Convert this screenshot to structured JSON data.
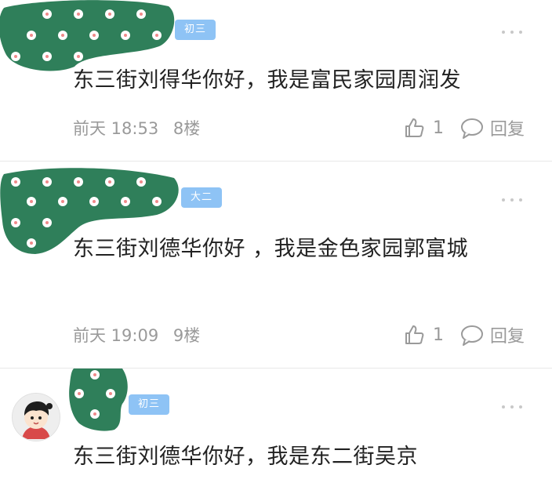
{
  "colors": {
    "blob": "#2f7f5a",
    "badge": "#8ec3f5",
    "text": "#222222",
    "meta": "#9a9a9a"
  },
  "comments": [
    {
      "badge": "初三",
      "content": "东三街刘得华你好，我是富民家园周润发",
      "time": "前天 18:53",
      "floor": "8楼",
      "likes": "1",
      "reply_label": "回复",
      "avatar": "blurred-flower-avatar"
    },
    {
      "badge": "大二",
      "content": "东三街刘德华你好 ，我是金色家园郭富城",
      "time": "前天 19:09",
      "floor": "9楼",
      "likes": "1",
      "reply_label": "回复",
      "avatar": "blurred-flower-avatar"
    },
    {
      "badge": "初三",
      "content": "东三街刘德华你好，我是东二街吴京",
      "avatar": "cartoon-kid-avatar"
    }
  ]
}
